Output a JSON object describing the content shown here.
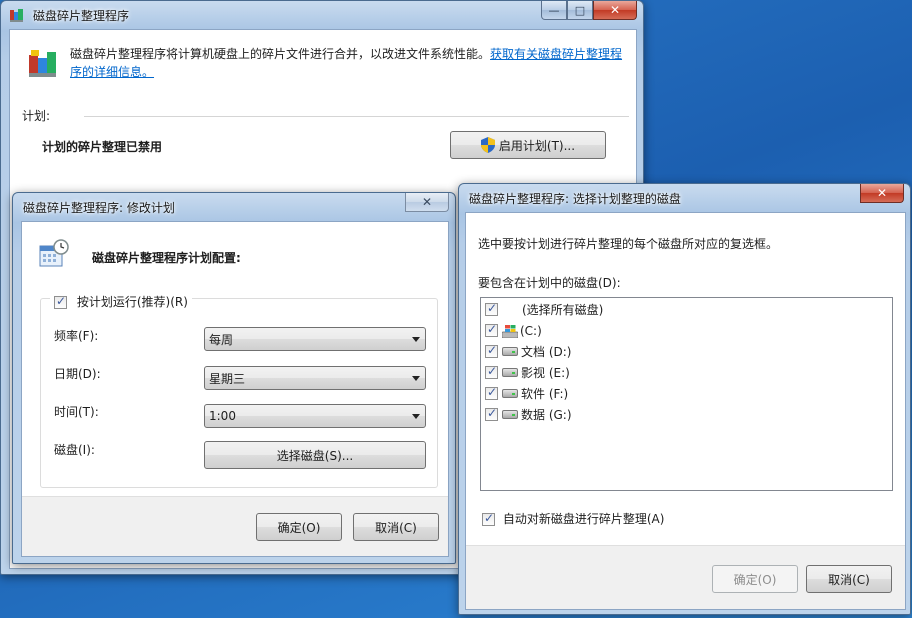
{
  "main_window": {
    "title": "磁盘碎片整理程序",
    "caption_min": "—",
    "caption_max": "□",
    "caption_close": "✕",
    "description": "磁盘碎片整理程序将计算机硬盘上的碎片文件进行合并，以改进文件系统性能。",
    "more_info_link": "获取有关磁盘碎片整理程序的详细信息。",
    "schedule_heading": "计划:",
    "schedule_status": "计划的碎片整理已禁用",
    "enable_schedule_button": "启用计划(T)..."
  },
  "modify_dialog": {
    "title": "磁盘碎片整理程序: 修改计划",
    "close": "✕",
    "heading": "磁盘碎片整理程序计划配置:",
    "run_on_schedule_label": "按计划运行(推荐)(R)",
    "run_on_schedule_checked": true,
    "frequency_label": "频率(F):",
    "frequency_value": "每周",
    "day_label": "日期(D):",
    "day_value": "星期三",
    "time_label": "时间(T):",
    "time_value": "1:00",
    "disks_label": "磁盘(I):",
    "select_disks_button": "选择磁盘(S)...",
    "ok_button": "确定(O)",
    "cancel_button": "取消(C)"
  },
  "select_dialog": {
    "title": "磁盘碎片整理程序: 选择计划整理的磁盘",
    "close": "✕",
    "instruction": "选中要按计划进行碎片整理的每个磁盘所对应的复选框。",
    "list_label": "要包含在计划中的磁盘(D):",
    "disks": [
      {
        "label": "(选择所有磁盘)",
        "checked": true,
        "icon": "none"
      },
      {
        "label": "(C:)",
        "checked": true,
        "icon": "system-drive-icon"
      },
      {
        "label": "文档 (D:)",
        "checked": true,
        "icon": "drive-icon"
      },
      {
        "label": "影视 (E:)",
        "checked": true,
        "icon": "drive-icon"
      },
      {
        "label": "软件 (F:)",
        "checked": true,
        "icon": "drive-icon"
      },
      {
        "label": "数据 (G:)",
        "checked": true,
        "icon": "drive-icon"
      }
    ],
    "auto_new_disks_label": "自动对新磁盘进行碎片整理(A)",
    "auto_new_disks_checked": true,
    "ok_button": "确定(O)",
    "ok_disabled": true,
    "cancel_button": "取消(C)"
  },
  "colors": {
    "link": "#0066cc",
    "desktop": "#1c5fb0",
    "close_button": "#c23a25"
  }
}
